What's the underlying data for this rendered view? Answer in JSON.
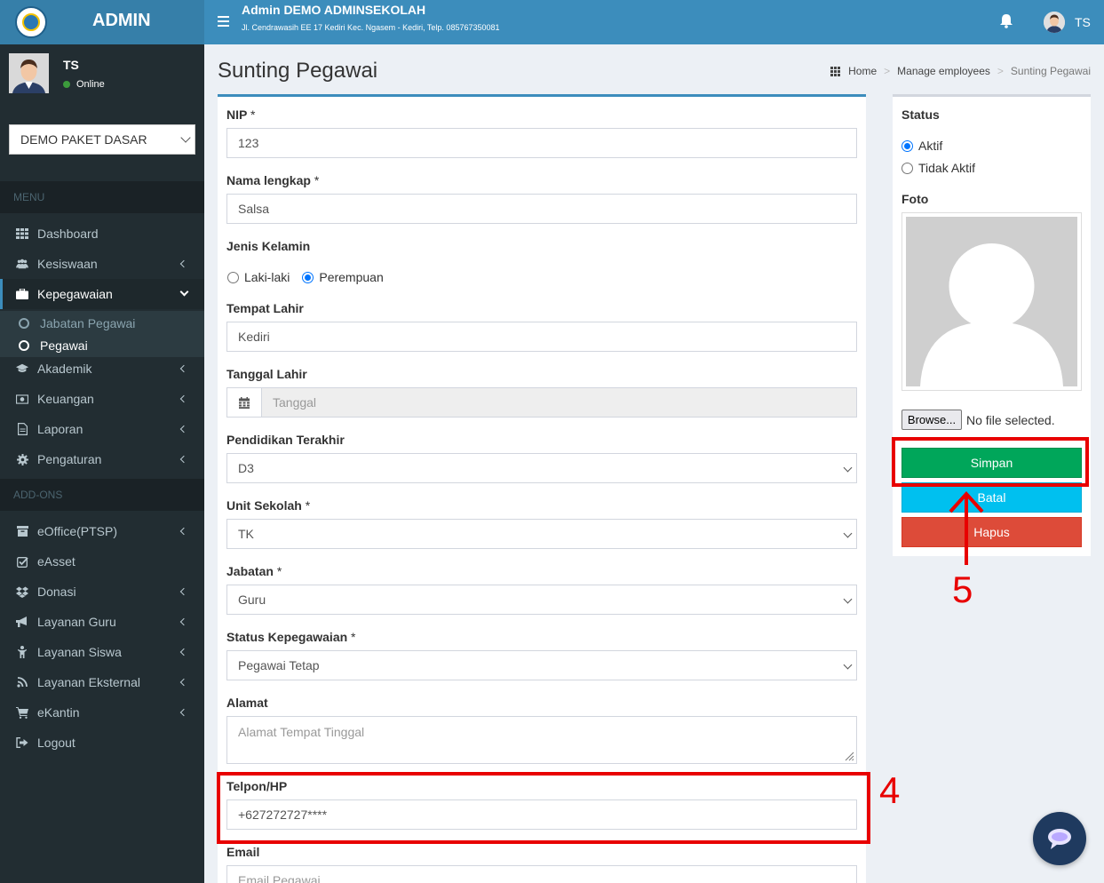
{
  "sidebar": {
    "brand": "ADMIN",
    "user_name": "TS",
    "user_status": "Online",
    "school_select": "DEMO PAKET DASAR",
    "menu_header": "MENU",
    "addons_header": "ADD-ONS",
    "menu": [
      {
        "label": "Dashboard",
        "icon": "dashboard-icon"
      },
      {
        "label": "Kesiswaan",
        "icon": "users-icon"
      },
      {
        "label": "Kepegawaian",
        "icon": "briefcase-icon"
      },
      {
        "label": "Akademik",
        "icon": "graduation-cap-icon"
      },
      {
        "label": "Keuangan",
        "icon": "money-icon"
      },
      {
        "label": "Laporan",
        "icon": "document-icon"
      },
      {
        "label": "Pengaturan",
        "icon": "gear-icon"
      }
    ],
    "submenu": [
      {
        "label": "Jabatan Pegawai"
      },
      {
        "label": "Pegawai"
      }
    ],
    "addons": [
      {
        "label": "eOffice(PTSP)",
        "icon": "archive-icon"
      },
      {
        "label": "eAsset",
        "icon": "check-square-icon"
      },
      {
        "label": "Donasi",
        "icon": "dropbox-icon"
      },
      {
        "label": "Layanan Guru",
        "icon": "bullhorn-icon"
      },
      {
        "label": "Layanan Siswa",
        "icon": "child-icon"
      },
      {
        "label": "Layanan Eksternal",
        "icon": "rss-icon"
      },
      {
        "label": "eKantin",
        "icon": "cart-icon"
      },
      {
        "label": "Logout",
        "icon": "sign-out-icon"
      }
    ]
  },
  "header": {
    "org_name": "Admin DEMO ADMINSEKOLAH",
    "address": "Jl. Cendrawasih EE 17 Kediri Kec. Ngasem - Kediri, Telp. 085767350081",
    "user_initials": "TS"
  },
  "page": {
    "title": "Sunting Pegawai",
    "breadcrumb": [
      "Home",
      "Manage employees",
      "Sunting Pegawai"
    ]
  },
  "form": {
    "nip_label": "NIP",
    "nip_value": "123",
    "nama_label": "Nama lengkap",
    "nama_value": "Salsa",
    "jk_label": "Jenis Kelamin",
    "jk_options": [
      "Laki-laki",
      "Perempuan"
    ],
    "tempat_label": "Tempat Lahir",
    "tempat_value": "Kediri",
    "tanggal_label": "Tanggal Lahir",
    "tanggal_placeholder": "Tanggal",
    "pendidikan_label": "Pendidikan Terakhir",
    "pendidikan_value": "D3",
    "unit_label": "Unit Sekolah",
    "unit_value": "TK",
    "jabatan_label": "Jabatan",
    "jabatan_value": "Guru",
    "status_peg_label": "Status Kepegawaian",
    "status_peg_value": "Pegawai Tetap",
    "alamat_label": "Alamat",
    "alamat_placeholder": "Alamat Tempat Tinggal",
    "telpon_label": "Telpon/HP",
    "telpon_value": "+627272727****",
    "email_label": "Email",
    "email_placeholder": "Email Pegawai",
    "required_mark": "*"
  },
  "side": {
    "status_label": "Status",
    "status_options": [
      "Aktif",
      "Tidak Aktif"
    ],
    "foto_label": "Foto",
    "browse_label": "Browse...",
    "no_file": "No file selected.",
    "save": "Simpan",
    "cancel": "Batal",
    "delete": "Hapus"
  },
  "annotations": {
    "step4": "4",
    "step5": "5"
  },
  "colors": {
    "header": "#3c8dbc",
    "sidebar": "#222d32",
    "save": "#00a65a",
    "cancel": "#00c0ef",
    "delete": "#dd4b39",
    "highlight": "#e80000"
  }
}
